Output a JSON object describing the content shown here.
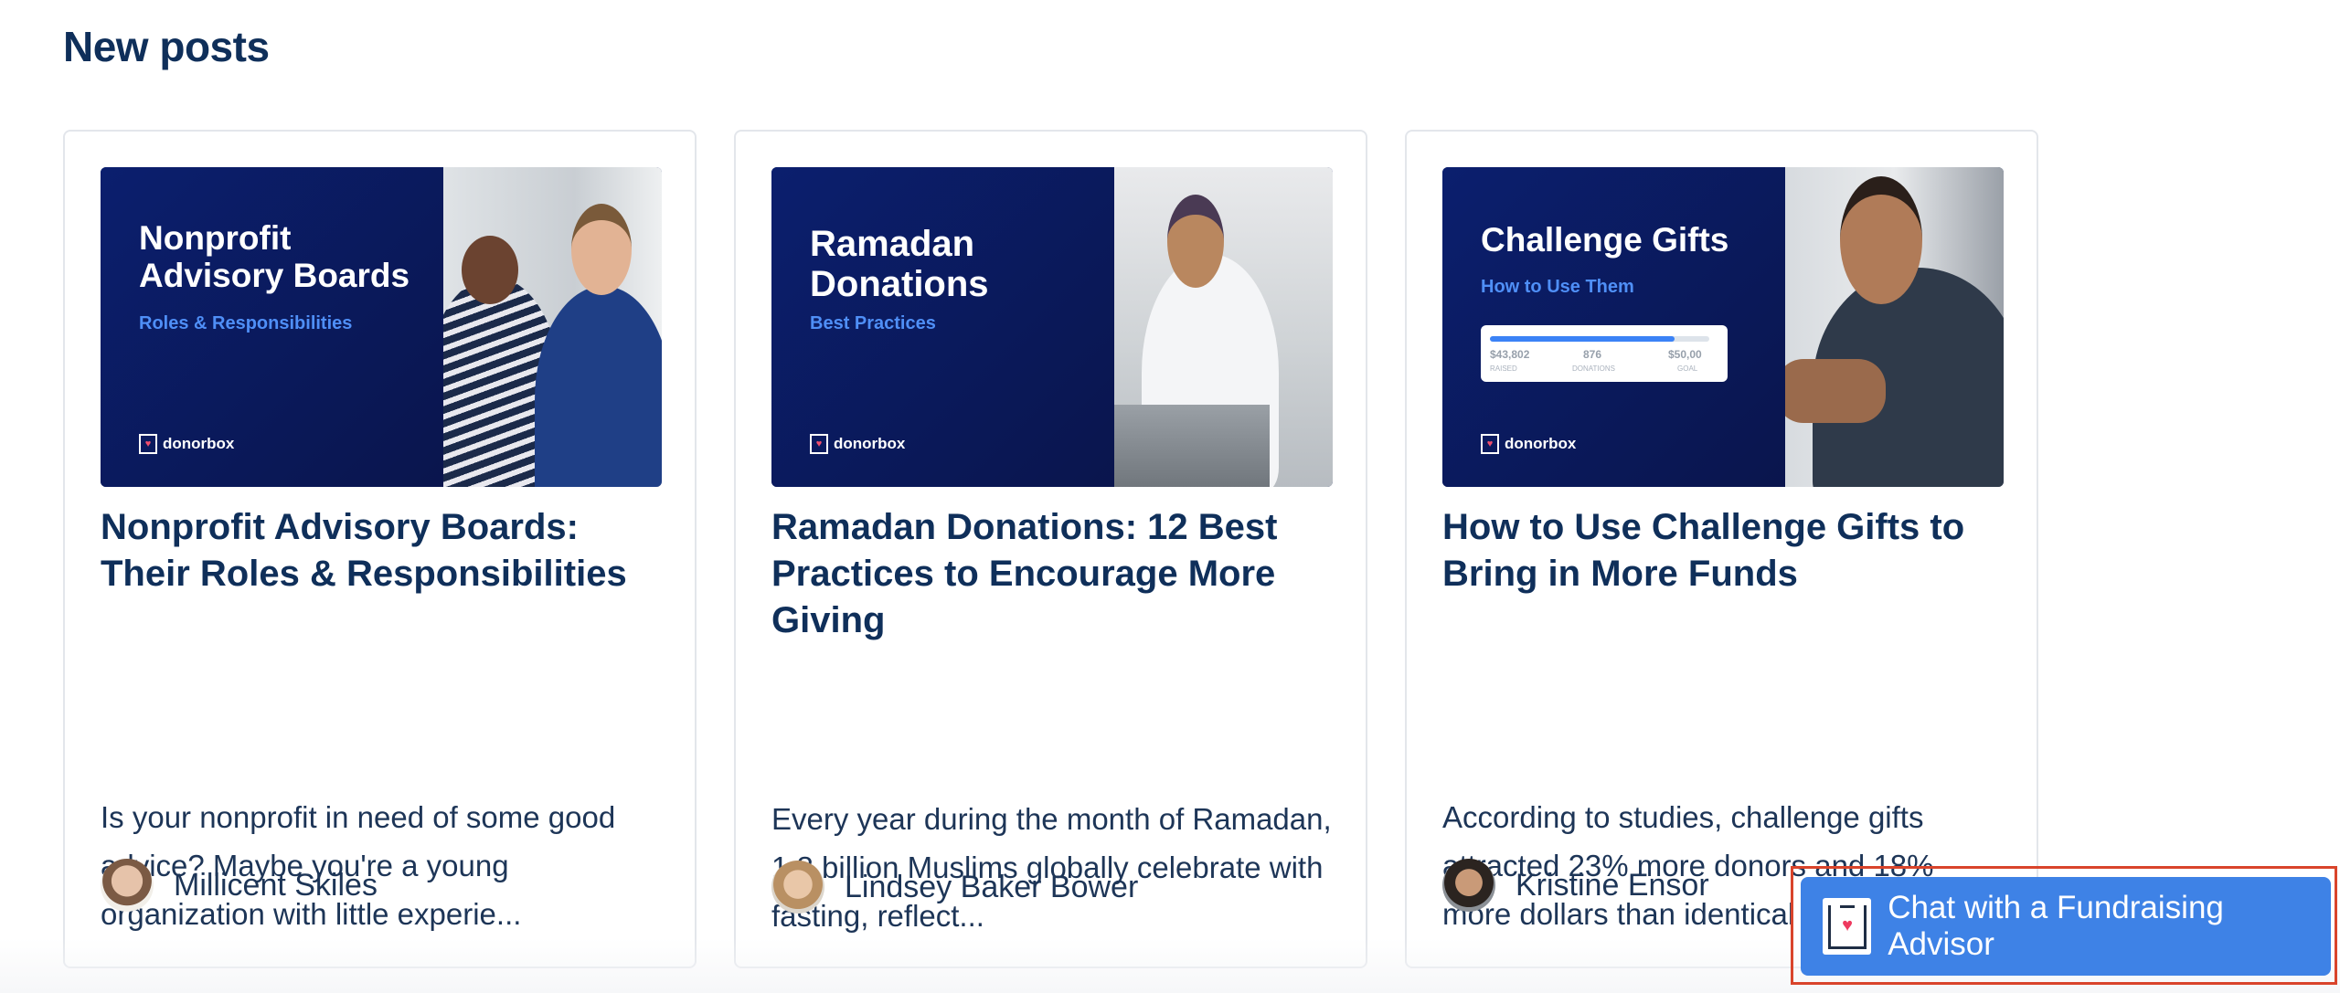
{
  "section": {
    "title": "New posts"
  },
  "posts": [
    {
      "banner_title": "Nonprofit\nAdvisory Boards",
      "banner_subtitle": "Roles & Responsibilities",
      "brand": "donorbox",
      "title": "Nonprofit Advisory Boards: Their Roles & Responsibilities",
      "excerpt": "Is your nonprofit in need of some good advice? Maybe you're a young organization with little experie...",
      "author": "Millicent Skiles"
    },
    {
      "banner_title": "Ramadan\nDonations",
      "banner_subtitle": "Best Practices",
      "brand": "donorbox",
      "title": "Ramadan Donations: 12 Best Practices to Encourage More Giving",
      "excerpt": "Every year during the month of Ramadan, 1.8 billion Muslims globally celebrate with fasting, reflect...",
      "author": "Lindsey Baker Bower"
    },
    {
      "banner_title": "Challenge Gifts",
      "banner_subtitle": "How to Use Them",
      "brand": "donorbox",
      "progress": {
        "raised": "$43,802",
        "raised_label": "RAISED",
        "donations": "876",
        "donations_label": "DONATIONS",
        "goal": "$50,00",
        "goal_label": "GOAL",
        "fill_fraction": 0.84
      },
      "title": "How to Use Challenge Gifts to Bring in More Funds",
      "excerpt": "According to studies, challenge gifts attracted 23% more donors and 18% more dollars than identical ...",
      "author": "Kristine Ensor"
    }
  ],
  "chat": {
    "label": "Chat with a Fundraising Advisor"
  },
  "colors": {
    "heading": "#0f2f5a",
    "accent": "#3e82e6",
    "banner": "#0b1f6e",
    "highlight_frame": "#d9442b"
  }
}
